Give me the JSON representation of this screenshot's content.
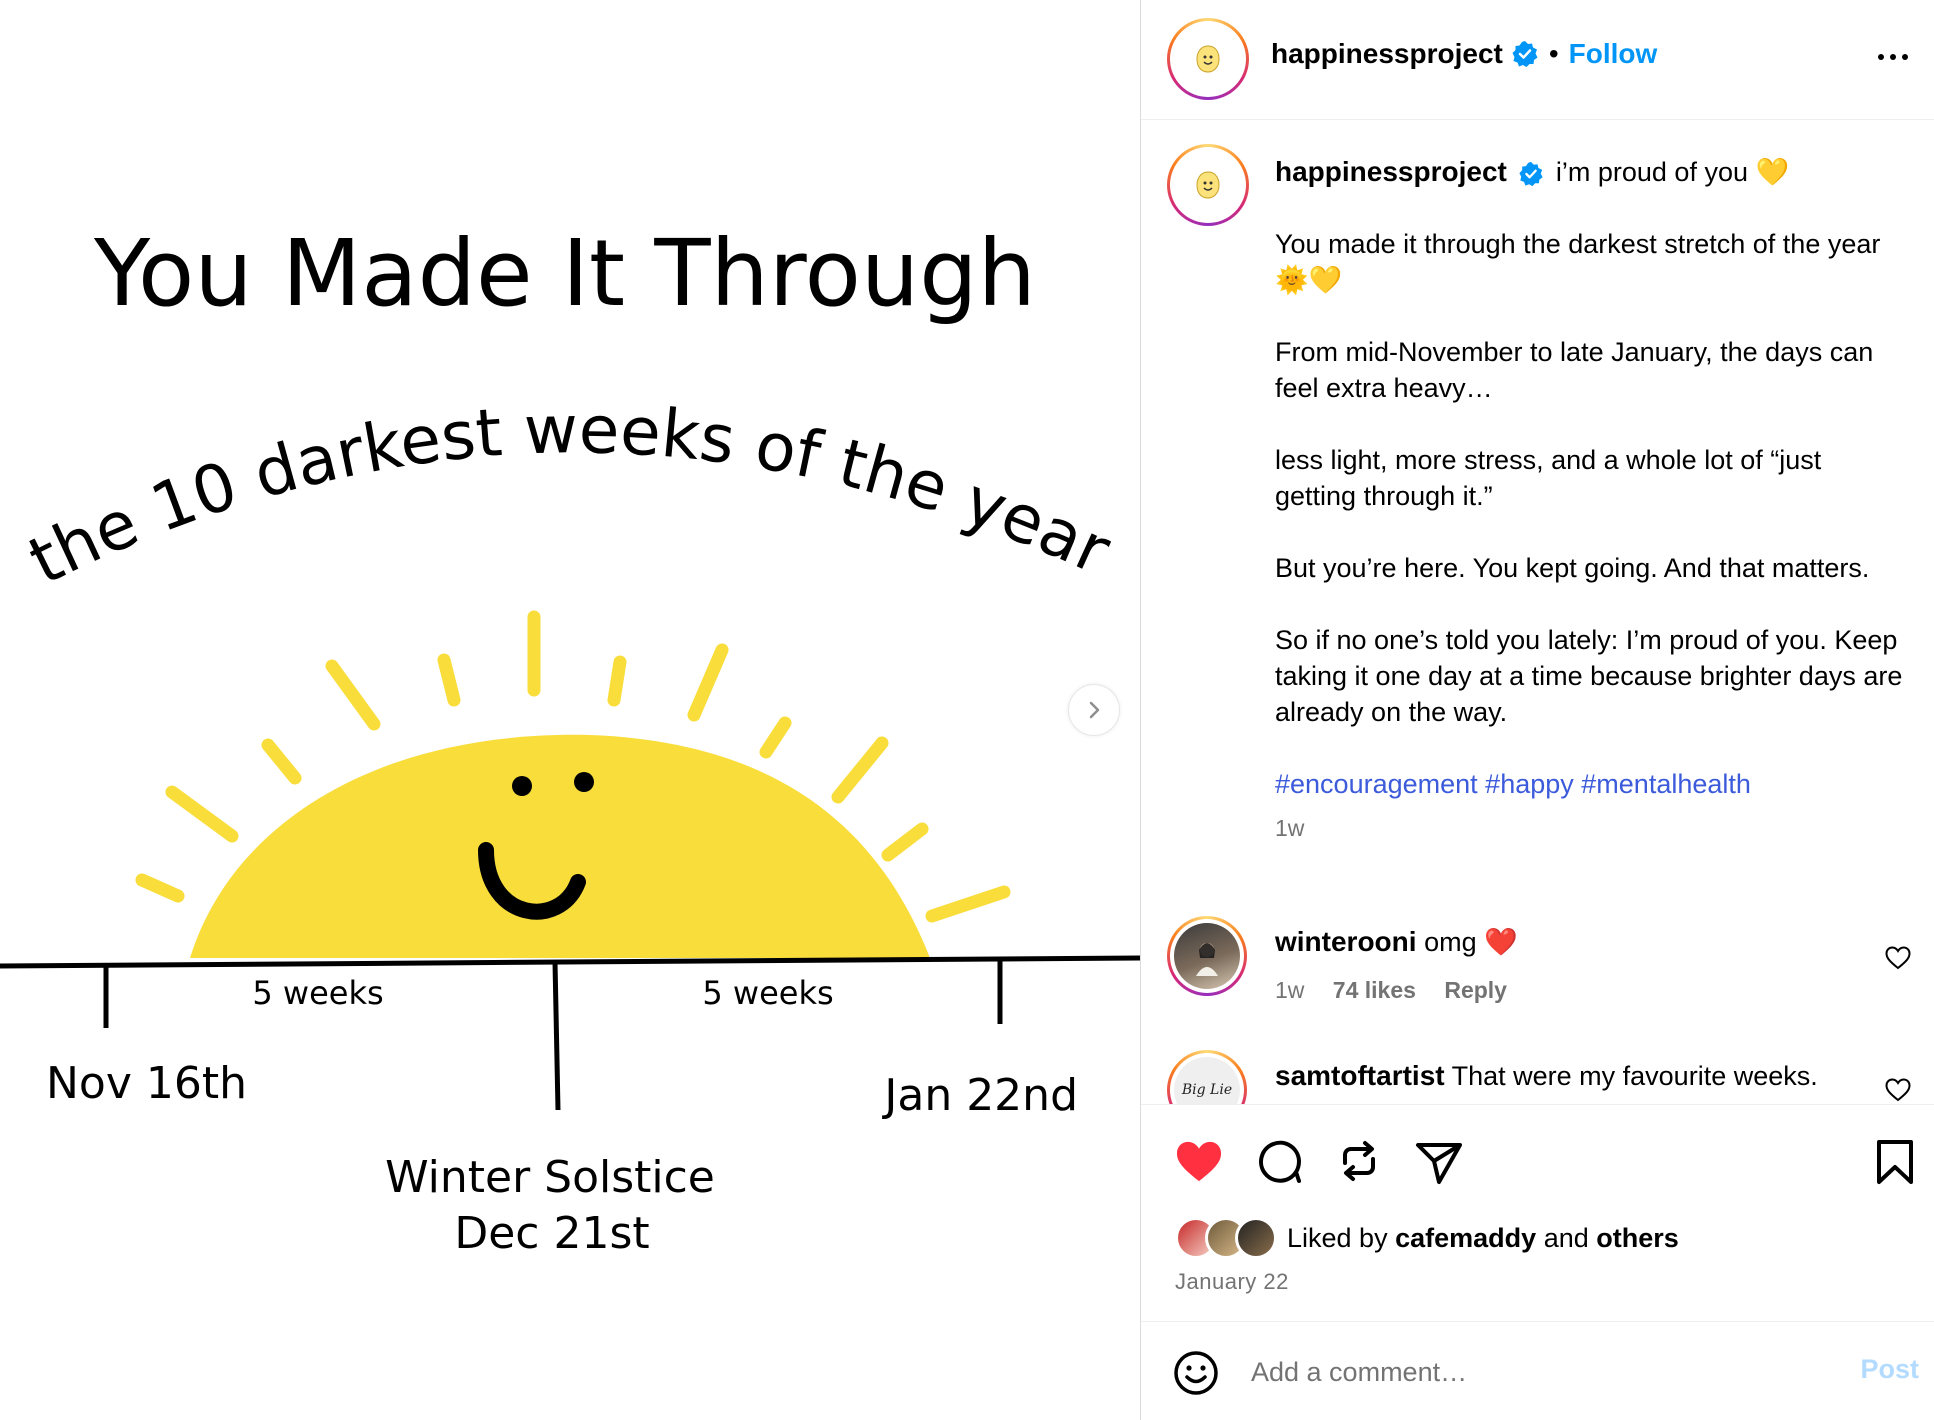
{
  "post_image": {
    "title": "You Made It Through",
    "subtitle": "the 10 darkest weeks of the year",
    "span_left": "5 weeks",
    "span_right": "5 weeks",
    "start_label": "Nov 16th",
    "end_label": "Jan 22nd",
    "mid_label_1": "Winter Solstice",
    "mid_label_2": "Dec 21st",
    "sun_color": "#F9DD3B",
    "next_icon": "chevron-right-icon"
  },
  "header": {
    "username": "happinessproject",
    "separator": "•",
    "follow_label": "Follow",
    "more_icon": "more-horizontal-icon"
  },
  "caption": {
    "username": "happinessproject",
    "lead": "i’m proud of you 💛",
    "para1": "You made it through the darkest stretch of the year 🌞💛",
    "para2": "From mid-November to late January, the days can feel extra heavy…",
    "para3": "less light, more stress, and a whole lot of “just getting through it.”",
    "para4": "But you’re here. You kept going. And that matters.",
    "para5": "So if no one’s told you lately: I’m proud of you. Keep taking it one day at a time because brighter days are already on the way.",
    "hashtags": [
      "#encouragement",
      "#happy",
      "#mentalhealth"
    ],
    "time": "1w"
  },
  "comments": [
    {
      "username": "winterooni",
      "text": "omg ❤️",
      "time": "1w",
      "likes": "74 likes",
      "reply": "Reply"
    },
    {
      "username": "samtoftartist",
      "text": "That were my favourite weeks.",
      "avatar_text": "Big Lie"
    }
  ],
  "actions": {
    "liked_prefix": "Liked by",
    "liked_user": "cafemaddy",
    "liked_and": "and",
    "liked_others": "others",
    "date": "January 22",
    "comment_placeholder": "Add a comment…",
    "post_label": "Post",
    "like_color": "#ff3040",
    "link_color": "#0095f6"
  }
}
